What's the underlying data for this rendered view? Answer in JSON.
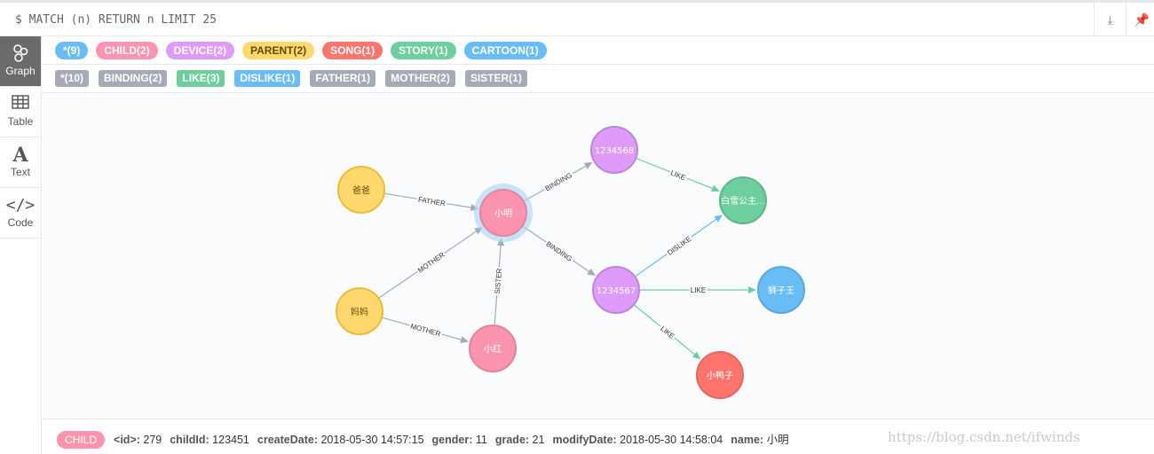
{
  "query": "$ MATCH (n) RETURN n LIMIT 25",
  "top_buttons": [
    {
      "icon": "download-icon"
    },
    {
      "icon": "pin-icon"
    }
  ],
  "sidebar": {
    "items": [
      {
        "label": "Graph",
        "icon": "graph-icon",
        "active": true
      },
      {
        "label": "Table",
        "icon": "table-icon"
      },
      {
        "label": "Text",
        "icon": "text-icon"
      },
      {
        "label": "Code",
        "icon": "code-icon"
      }
    ]
  },
  "node_labels": [
    {
      "label": "*(9)",
      "color": "#68bdf6",
      "text": "#fff"
    },
    {
      "label": "CHILD(2)",
      "color": "#fb95af",
      "text": "#fff"
    },
    {
      "label": "DEVICE(2)",
      "color": "#de9bf9",
      "text": "#fff"
    },
    {
      "label": "PARENT(2)",
      "color": "#ffd86e",
      "text": "#604a0e"
    },
    {
      "label": "SONG(1)",
      "color": "#ff756e",
      "text": "#fff"
    },
    {
      "label": "STORY(1)",
      "color": "#6dce9e",
      "text": "#fff"
    },
    {
      "label": "CARTOON(1)",
      "color": "#68bdf6",
      "text": "#fff"
    }
  ],
  "relationship_types": [
    {
      "label": "*(10)",
      "color": "#a5abb6"
    },
    {
      "label": "BINDING(2)",
      "color": "#a5abb6"
    },
    {
      "label": "LIKE(3)",
      "color": "#6dce9e"
    },
    {
      "label": "DISLIKE(1)",
      "color": "#68bdf6"
    },
    {
      "label": "FATHER(1)",
      "color": "#a5abb6"
    },
    {
      "label": "MOTHER(2)",
      "color": "#a5abb6"
    },
    {
      "label": "SISTER(1)",
      "color": "#a5abb6"
    }
  ],
  "graph": {
    "nodes": [
      {
        "id": "baba",
        "caption": "爸爸",
        "fill": "#ffd86e",
        "stroke": "#edba39",
        "text": "#604a0e"
      },
      {
        "id": "mama",
        "caption": "妈妈",
        "fill": "#ffd86e",
        "stroke": "#edba39",
        "text": "#604a0e"
      },
      {
        "id": "xiaoming",
        "caption": "小明",
        "fill": "#fb95af",
        "stroke": "#e0849b",
        "text": "#fff",
        "selected": true
      },
      {
        "id": "xiaohong",
        "caption": "小红",
        "fill": "#fb95af",
        "stroke": "#e0849b",
        "text": "#fff"
      },
      {
        "id": "d8",
        "caption": "1234568",
        "fill": "#de9bf9",
        "stroke": "#bf85d6",
        "text": "#fff"
      },
      {
        "id": "d7",
        "caption": "1234567",
        "fill": "#de9bf9",
        "stroke": "#bf85d6",
        "text": "#fff"
      },
      {
        "id": "snow",
        "caption": "白雪公主...",
        "fill": "#6dce9e",
        "stroke": "#60b58b",
        "text": "#fff"
      },
      {
        "id": "lion",
        "caption": "狮子王",
        "fill": "#68bdf6",
        "stroke": "#5ca8db",
        "text": "#fff"
      },
      {
        "id": "duck",
        "caption": "小鸭子",
        "fill": "#ff756e",
        "stroke": "#e06760",
        "text": "#fff"
      }
    ],
    "edges": [
      {
        "from": "baba",
        "to": "xiaoming",
        "type": "FATHER",
        "color": "#a5abb6"
      },
      {
        "from": "mama",
        "to": "xiaoming",
        "type": "MOTHER",
        "color": "#a5abb6"
      },
      {
        "from": "mama",
        "to": "xiaohong",
        "type": "MOTHER",
        "color": "#a5abb6"
      },
      {
        "from": "xiaohong",
        "to": "xiaoming",
        "type": "SISTER",
        "color": "#a5abb6"
      },
      {
        "from": "xiaoming",
        "to": "d8",
        "type": "BINDING",
        "color": "#a5abb6"
      },
      {
        "from": "xiaoming",
        "to": "d7",
        "type": "BINDING",
        "color": "#a5abb6"
      },
      {
        "from": "d8",
        "to": "snow",
        "type": "LIKE",
        "color": "#6dce9e"
      },
      {
        "from": "d7",
        "to": "snow",
        "type": "DISLIKE",
        "color": "#68bdf6"
      },
      {
        "from": "d7",
        "to": "lion",
        "type": "LIKE",
        "color": "#6dce9e"
      },
      {
        "from": "d7",
        "to": "duck",
        "type": "LIKE",
        "color": "#6dce9e"
      }
    ]
  },
  "footer": {
    "label": "CHILD",
    "label_color": "#fb95af",
    "props": [
      {
        "key": "<id>:",
        "value": "279"
      },
      {
        "key": "childId:",
        "value": "123451"
      },
      {
        "key": "createDate:",
        "value": "2018-05-30 14:57:15"
      },
      {
        "key": "gender:",
        "value": "11"
      },
      {
        "key": "grade:",
        "value": "21"
      },
      {
        "key": "modifyDate:",
        "value": "2018-05-30 14:58:04"
      },
      {
        "key": "name:",
        "value": "小明"
      }
    ]
  },
  "watermark": "https://blog.csdn.net/ifwinds"
}
